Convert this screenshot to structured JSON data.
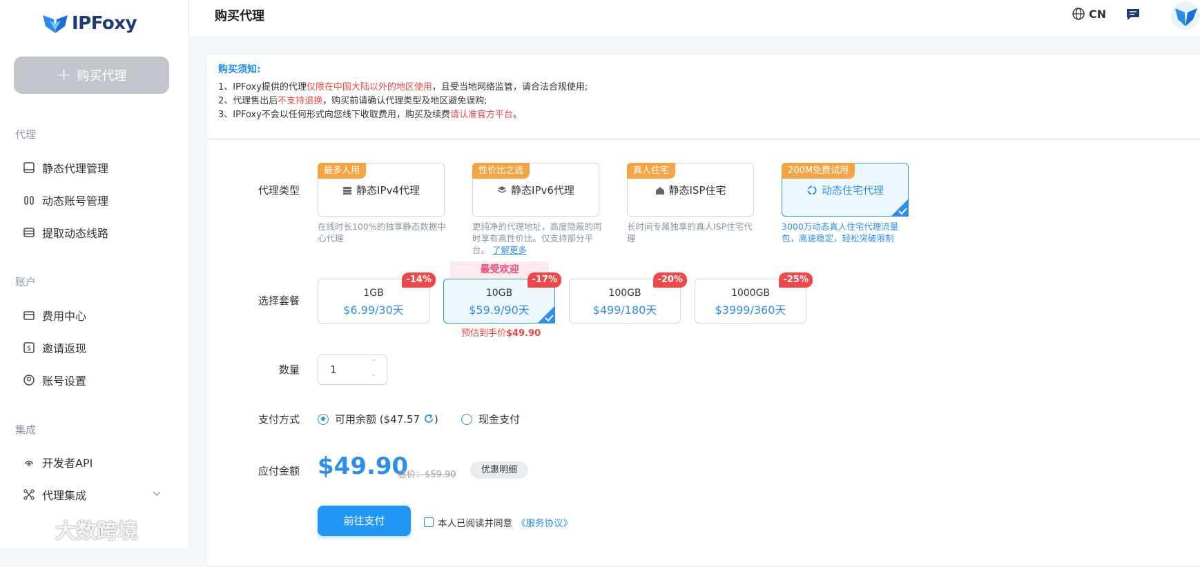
{
  "app": {
    "logo_text": "IPFoxy",
    "buy_button": "购买代理",
    "page_title": "购买代理",
    "language": "CN"
  },
  "sidebar": {
    "sections": [
      {
        "title": "代理",
        "items": [
          {
            "label": "静态代理管理",
            "icon": "server-icon"
          },
          {
            "label": "动态账号管理",
            "icon": "users-icon"
          },
          {
            "label": "提取动态线路",
            "icon": "list-icon"
          }
        ]
      },
      {
        "title": "账户",
        "items": [
          {
            "label": "费用中心",
            "icon": "wallet-icon"
          },
          {
            "label": "邀请返现",
            "icon": "dollar-icon"
          },
          {
            "label": "账号设置",
            "icon": "user-icon"
          }
        ]
      },
      {
        "title": "集成",
        "items": [
          {
            "label": "开发者API",
            "icon": "fingerprint-icon"
          },
          {
            "label": "代理集成",
            "icon": "nodes-icon"
          }
        ]
      }
    ]
  },
  "watermark": "大数跨境",
  "notice": {
    "title": "购买须知:",
    "line1": {
      "a": "1、IPFoxy提供的代理",
      "b": "仅限在中国大陆以外的地区使用",
      "c": "，且受当地网络监管，请合法合规使用;"
    },
    "line2": {
      "a": "2、代理售出后",
      "b": "不支持退换",
      "c": "，购买前请确认代理类型及地区避免误购;"
    },
    "line3": {
      "a": "3、IPFoxy不会以任何形式向您线下收取费用，购买及续费",
      "b": "请认准官方平台",
      "c": "。"
    }
  },
  "form": {
    "proxy_type_label": "代理类型",
    "package_label": "选择套餐",
    "quantity_label": "数量",
    "payment_label": "支付方式",
    "amount_label": "应付金额"
  },
  "proxy_types": [
    {
      "tag": "最多人用",
      "name": "静态IPv4代理",
      "desc": "在线时长100%的独享静态数据中心代理",
      "selected": false
    },
    {
      "tag": "性价比之选",
      "name": "静态IPv6代理",
      "desc": "更纯净的代理地址，高度隐蔽的同时享有高性价比。仅支持部分平台。",
      "learn_more": "了解更多",
      "selected": false
    },
    {
      "tag": "真人住宅",
      "name": "静态ISP住宅",
      "desc": "长时间专属独享的真人ISP住宅代理",
      "selected": false
    },
    {
      "tag": "200M免费试用",
      "name": "动态住宅代理",
      "desc": "3000万动态真人住宅代理流量包，高速稳定，轻松突破限制",
      "selected": true
    }
  ],
  "packages": [
    {
      "size": "1GB",
      "price": "$6.99/30天",
      "discount": "-14%",
      "selected": false
    },
    {
      "size": "10GB",
      "price": "$59.9/90天",
      "discount": "-17%",
      "selected": true
    },
    {
      "size": "100GB",
      "price": "$499/180天",
      "discount": "-20%",
      "selected": false
    },
    {
      "size": "1000GB",
      "price": "$3999/360天",
      "discount": "-25%",
      "selected": false
    }
  ],
  "popular_label": "最受欢迎",
  "estimate": {
    "text": "预估到手价",
    "value": "$49.90"
  },
  "quantity": {
    "value": "1"
  },
  "payment": {
    "balance_label": "可用余额 ($47.57",
    "balance_close": ")",
    "cash_label": "现金支付",
    "selected": "balance"
  },
  "amount": {
    "value": "$49.90",
    "original": "总价：$59.90",
    "detail_button": "优惠明细"
  },
  "pay_button": "前往支付",
  "agreement": {
    "text": "本人已阅读并同意",
    "link": "《服务协议》"
  },
  "colors": {
    "accent": "#2f8ee8",
    "tag": "#f3a545",
    "discount": "#f04848",
    "danger": "#e84545"
  }
}
